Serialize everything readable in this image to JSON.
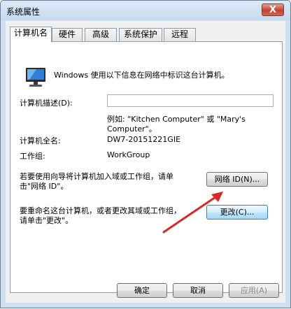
{
  "window": {
    "title": "系统属性",
    "close_label": "X"
  },
  "tabs": [
    {
      "label": "计算机名",
      "active": true
    },
    {
      "label": "硬件",
      "active": false
    },
    {
      "label": "高级",
      "active": false
    },
    {
      "label": "系统保护",
      "active": false
    },
    {
      "label": "远程",
      "active": false
    }
  ],
  "computer_name": {
    "intro": "Windows 使用以下信息在网络中标识这台计算机。",
    "description_label": "计算机描述(D):",
    "description_value": "",
    "example_line1": "例如: \"Kitchen Computer\" 或 \"Mary's",
    "example_line2": "Computer\"。",
    "fullname_label": "计算机全名:",
    "fullname_value": "DW7-20151221GIE",
    "workgroup_label": "工作组:",
    "workgroup_value": "WorkGroup",
    "wizard_text_line1": "若要使用向导将计算机加入域或工作组，请单",
    "wizard_text_line2": "击\"网络 ID\"。",
    "network_id_button": "网络 ID(N)...",
    "rename_text_line1": "要重命名这台计算机，或者更改其域或工作组，",
    "rename_text_line2": "请单击\"更改\"。",
    "change_button": "更改(C)..."
  },
  "footer": {
    "ok": "确定",
    "cancel": "取消",
    "apply": "应用(A)"
  },
  "colors": {
    "arrow": "#d42a2a"
  }
}
